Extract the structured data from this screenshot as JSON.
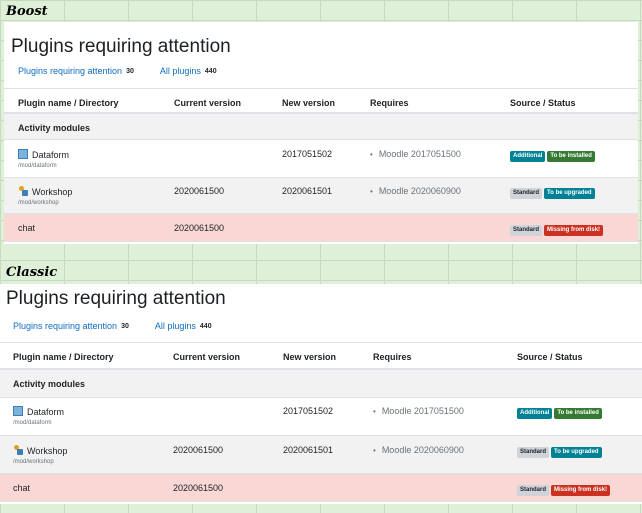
{
  "sections": [
    {
      "label": "Boost",
      "title": "Plugins requiring attention",
      "nav": [
        {
          "label": "Plugins requiring attention",
          "count": "30"
        },
        {
          "label": "All plugins",
          "count": "440"
        }
      ],
      "headers": [
        "Plugin name / Directory",
        "Current version",
        "New version",
        "Requires",
        "Source / Status"
      ],
      "group": "Activity modules",
      "rows": [
        {
          "name": "Dataform",
          "dir": "/mod/dataform",
          "current": "",
          "new": "2017051502",
          "requires": "Moodle 2017051500",
          "source": "Additional",
          "status": "To be installed"
        },
        {
          "name": "Workshop",
          "dir": "/mod/workshop",
          "current": "2020061500",
          "new": "2020061501",
          "requires": "Moodle 2020060900",
          "source": "Standard",
          "status": "To be upgraded"
        },
        {
          "name": "chat",
          "dir": "",
          "current": "2020061500",
          "new": "",
          "requires": "",
          "source": "Standard",
          "status": "Missing from disk!"
        }
      ]
    },
    {
      "label": "Classic",
      "title": "Plugins requiring attention",
      "nav": [
        {
          "label": "Plugins requiring attention",
          "count": "30"
        },
        {
          "label": "All plugins",
          "count": "440"
        }
      ],
      "headers": [
        "Plugin name / Directory",
        "Current version",
        "New version",
        "Requires",
        "Source / Status"
      ],
      "group": "Activity modules",
      "rows": [
        {
          "name": "Dataform",
          "dir": "/mod/dataform",
          "current": "",
          "new": "2017051502",
          "requires": "Moodle 2017051500",
          "source": "Additional",
          "status": "To be installed"
        },
        {
          "name": "Workshop",
          "dir": "/mod/workshop",
          "current": "2020061500",
          "new": "2020061501",
          "requires": "Moodle 2020060900",
          "source": "Standard",
          "status": "To be upgraded"
        },
        {
          "name": "chat",
          "dir": "",
          "current": "2020061500",
          "new": "",
          "requires": "",
          "source": "Standard",
          "status": "Missing from disk!"
        }
      ]
    }
  ],
  "colors": {
    "link": "#0f6cbf",
    "info": "#008196",
    "success": "#357a32",
    "danger": "#ca3120",
    "danger_row": "#f8d7d5"
  }
}
